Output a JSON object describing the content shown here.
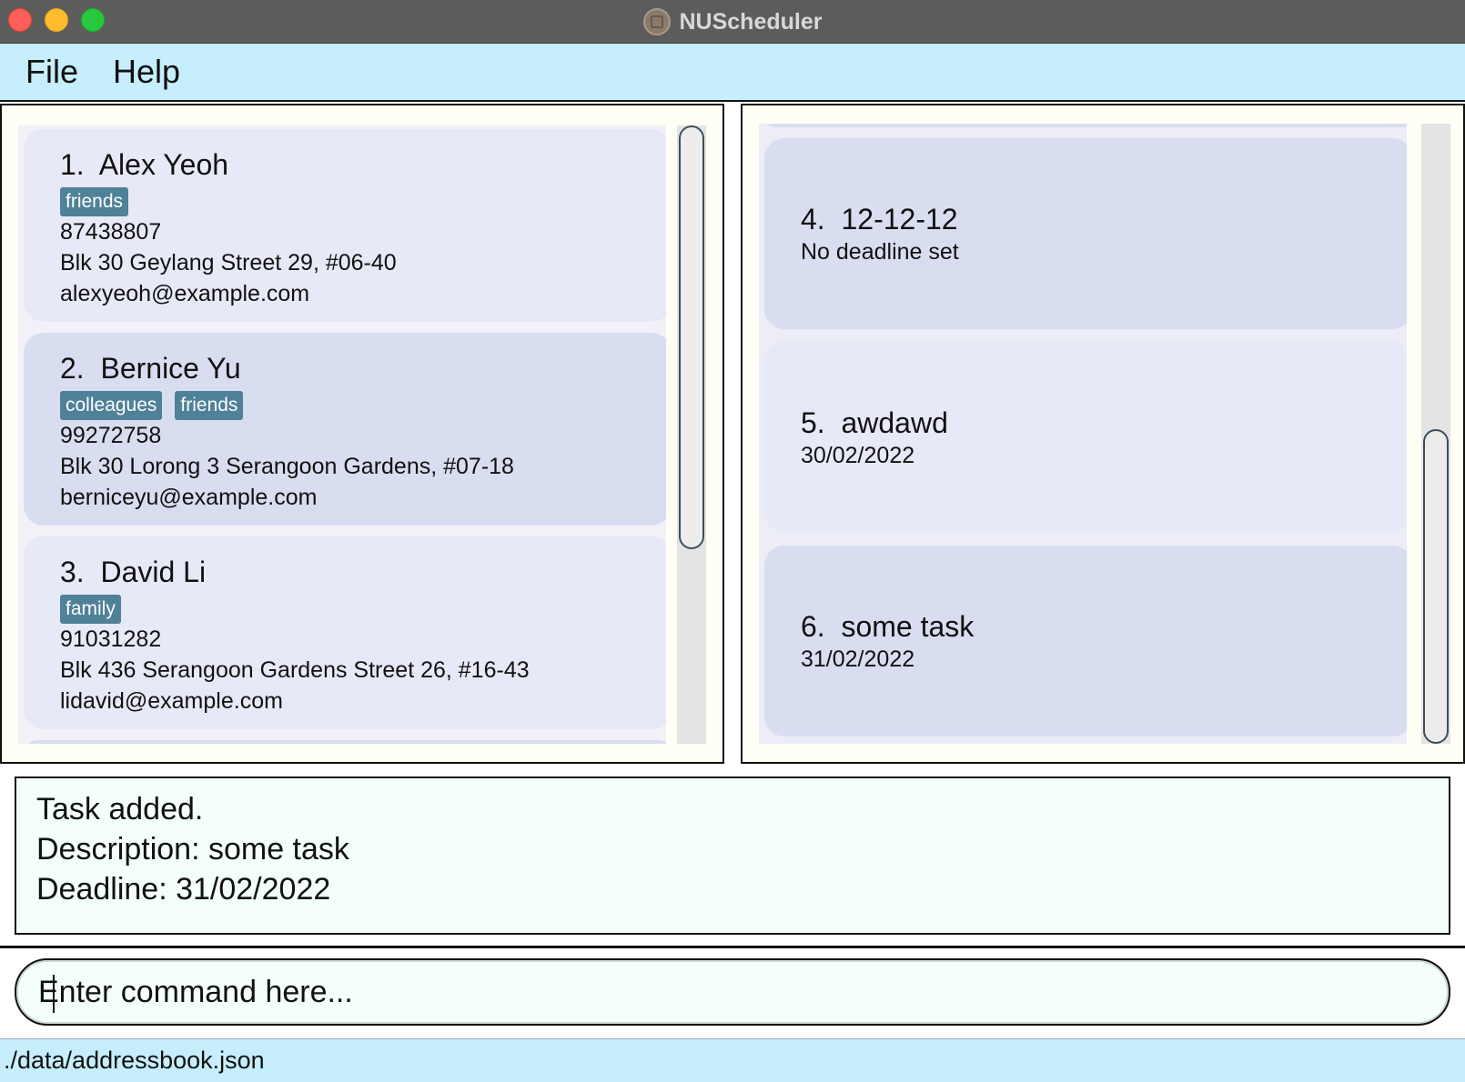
{
  "window": {
    "title": "NUScheduler"
  },
  "menu": {
    "file": "File",
    "help": "Help"
  },
  "persons": [
    {
      "index": "1.",
      "name": "Alex Yeoh",
      "tags": [
        "friends"
      ],
      "phone": "87438807",
      "address": "Blk 30 Geylang Street 29, #06-40",
      "email": "alexyeoh@example.com"
    },
    {
      "index": "2.",
      "name": "Bernice Yu",
      "tags": [
        "colleagues",
        "friends"
      ],
      "phone": "99272758",
      "address": "Blk 30 Lorong 3 Serangoon Gardens, #07-18",
      "email": "berniceyu@example.com"
    },
    {
      "index": "3.",
      "name": "David Li",
      "tags": [
        "family"
      ],
      "phone": "91031282",
      "address": "Blk 436 Serangoon Gardens Street 26, #16-43",
      "email": "lidavid@example.com"
    }
  ],
  "tasks": [
    {
      "index": "4.",
      "description": "12-12-12",
      "deadline": "No deadline set"
    },
    {
      "index": "5.",
      "description": "awdawd",
      "deadline": "30/02/2022"
    },
    {
      "index": "6.",
      "description": "some task",
      "deadline": "31/02/2022"
    }
  ],
  "result": {
    "line1": "Task added.",
    "line2": "Description: some task",
    "line3": "Deadline: 31/02/2022"
  },
  "command": {
    "placeholder": "Enter command here...",
    "value": ""
  },
  "status": {
    "file_path": "./data/addressbook.json"
  },
  "icons": {
    "app": "calendar-app-icon"
  },
  "colors": {
    "tag_bg": "#4f8198",
    "menubar_bg": "#c6eefc",
    "card_odd": "#e8e9f6",
    "card_even": "#d9ddf0"
  }
}
